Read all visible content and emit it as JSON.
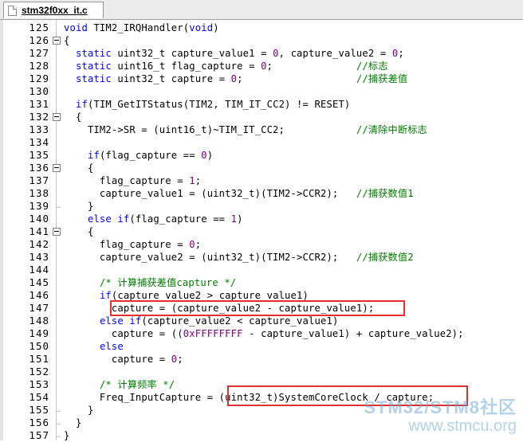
{
  "tab": {
    "label": "stm32f0xx_it.c"
  },
  "watermark": {
    "title": "STM32/STM8社区",
    "url": "www.stmcu.org"
  },
  "lines": [
    {
      "n": "125",
      "fold": "none",
      "code": [
        [
          "kw",
          "void"
        ],
        [
          "t",
          " TIM2_IRQHandler("
        ],
        [
          "kw",
          "void"
        ],
        [
          "t",
          ")"
        ]
      ]
    },
    {
      "n": "126",
      "fold": "open",
      "code": [
        [
          "t",
          "{"
        ]
      ]
    },
    {
      "n": "127",
      "fold": "line",
      "code": [
        [
          "t",
          "  "
        ],
        [
          "kw",
          "static"
        ],
        [
          "t",
          " uint32_t capture_value1 = "
        ],
        [
          "nm",
          "0"
        ],
        [
          "t",
          ", capture_value2 = "
        ],
        [
          "nm",
          "0"
        ],
        [
          "t",
          ";"
        ]
      ]
    },
    {
      "n": "128",
      "fold": "line",
      "code": [
        [
          "t",
          "  "
        ],
        [
          "kw",
          "static"
        ],
        [
          "t",
          " uint16_t flag_capture = "
        ],
        [
          "nm",
          "0"
        ],
        [
          "t",
          ";              "
        ],
        [
          "cm",
          "//标志"
        ]
      ]
    },
    {
      "n": "129",
      "fold": "line",
      "code": [
        [
          "t",
          "  "
        ],
        [
          "kw",
          "static"
        ],
        [
          "t",
          " uint32_t capture = "
        ],
        [
          "nm",
          "0"
        ],
        [
          "t",
          ";                   "
        ],
        [
          "cm",
          "//捕获差值"
        ]
      ]
    },
    {
      "n": "130",
      "fold": "line",
      "code": []
    },
    {
      "n": "131",
      "fold": "line",
      "code": [
        [
          "t",
          "  "
        ],
        [
          "kw",
          "if"
        ],
        [
          "t",
          "(TIM_GetITStatus(TIM2, TIM_IT_CC2) != RESET)"
        ]
      ]
    },
    {
      "n": "132",
      "fold": "open",
      "code": [
        [
          "t",
          "  {"
        ]
      ]
    },
    {
      "n": "133",
      "fold": "line",
      "code": [
        [
          "t",
          "    TIM2->SR = (uint16_t)~TIM_IT_CC2;            "
        ],
        [
          "cm",
          "//清除中断标志"
        ]
      ]
    },
    {
      "n": "134",
      "fold": "line",
      "code": []
    },
    {
      "n": "135",
      "fold": "line",
      "code": [
        [
          "t",
          "    "
        ],
        [
          "kw",
          "if"
        ],
        [
          "t",
          "(flag_capture == "
        ],
        [
          "nm",
          "0"
        ],
        [
          "t",
          ")"
        ]
      ]
    },
    {
      "n": "136",
      "fold": "open",
      "code": [
        [
          "t",
          "    {"
        ]
      ]
    },
    {
      "n": "137",
      "fold": "line",
      "code": [
        [
          "t",
          "      flag_capture = "
        ],
        [
          "nm",
          "1"
        ],
        [
          "t",
          ";"
        ]
      ]
    },
    {
      "n": "138",
      "fold": "line",
      "code": [
        [
          "t",
          "      capture_value1 = (uint32_t)(TIM2->CCR2);   "
        ],
        [
          "cm",
          "//捕获数值1"
        ]
      ]
    },
    {
      "n": "139",
      "fold": "end",
      "code": [
        [
          "t",
          "    }"
        ]
      ]
    },
    {
      "n": "140",
      "fold": "line",
      "code": [
        [
          "t",
          "    "
        ],
        [
          "kw",
          "else if"
        ],
        [
          "t",
          "(flag_capture == "
        ],
        [
          "nm",
          "1"
        ],
        [
          "t",
          ")"
        ]
      ]
    },
    {
      "n": "141",
      "fold": "open",
      "code": [
        [
          "t",
          "    {"
        ]
      ]
    },
    {
      "n": "142",
      "fold": "line",
      "code": [
        [
          "t",
          "      flag_capture = "
        ],
        [
          "nm",
          "0"
        ],
        [
          "t",
          ";"
        ]
      ]
    },
    {
      "n": "143",
      "fold": "line",
      "code": [
        [
          "t",
          "      capture_value2 = (uint32_t)(TIM2->CCR2);   "
        ],
        [
          "cm",
          "//捕获数值2"
        ]
      ]
    },
    {
      "n": "144",
      "fold": "line",
      "code": []
    },
    {
      "n": "145",
      "fold": "line",
      "code": [
        [
          "t",
          "      "
        ],
        [
          "cm",
          "/* 计算捕获差值capture */"
        ]
      ]
    },
    {
      "n": "146",
      "fold": "line",
      "code": [
        [
          "t",
          "      "
        ],
        [
          "kw",
          "if"
        ],
        [
          "t",
          "(capture_value2 > capture_value1)"
        ]
      ]
    },
    {
      "n": "147",
      "fold": "line",
      "code": [
        [
          "t",
          "        capture = (capture_value2 - capture_value1);"
        ]
      ]
    },
    {
      "n": "148",
      "fold": "line",
      "code": [
        [
          "t",
          "      "
        ],
        [
          "kw",
          "else if"
        ],
        [
          "t",
          "(capture_value2 < capture_value1)"
        ]
      ]
    },
    {
      "n": "149",
      "fold": "line",
      "code": [
        [
          "t",
          "        capture = (("
        ],
        [
          "nm",
          "0xFFFFFFFF"
        ],
        [
          "t",
          " - capture_value1) + capture_value2);"
        ]
      ]
    },
    {
      "n": "150",
      "fold": "line",
      "code": [
        [
          "t",
          "      "
        ],
        [
          "kw",
          "else"
        ]
      ]
    },
    {
      "n": "151",
      "fold": "line",
      "code": [
        [
          "t",
          "        capture = "
        ],
        [
          "nm",
          "0"
        ],
        [
          "t",
          ";"
        ]
      ]
    },
    {
      "n": "152",
      "fold": "line",
      "code": []
    },
    {
      "n": "153",
      "fold": "line",
      "code": [
        [
          "t",
          "      "
        ],
        [
          "cm",
          "/* 计算频率 */"
        ]
      ]
    },
    {
      "n": "154",
      "fold": "line",
      "code": [
        [
          "t",
          "      Freq_InputCapture = (uint32_t)SystemCoreClock / capture;"
        ]
      ]
    },
    {
      "n": "155",
      "fold": "end",
      "code": [
        [
          "t",
          "    }"
        ]
      ]
    },
    {
      "n": "156",
      "fold": "end",
      "code": [
        [
          "t",
          "  }"
        ]
      ]
    },
    {
      "n": "157",
      "fold": "end",
      "code": [
        [
          "t",
          "}"
        ]
      ]
    }
  ],
  "highlights": [
    {
      "line": "147",
      "note": "capture = (capture_value2 - capture_value1);"
    },
    {
      "line": "154",
      "note": "(uint32_t)SystemCoreClock / capture;"
    }
  ]
}
